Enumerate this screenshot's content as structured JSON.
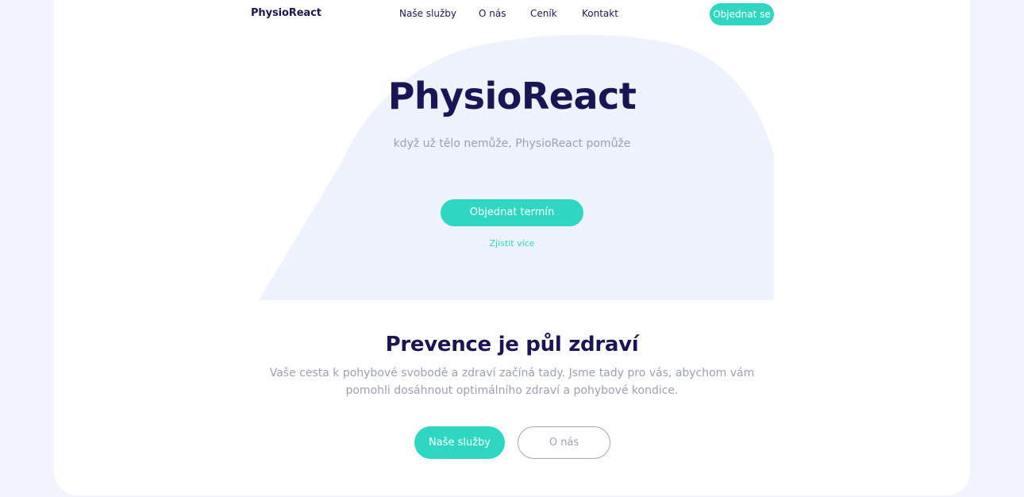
{
  "nav": {
    "brand": "PhysioReact",
    "links": [
      "Naše služby",
      "O nás",
      "Ceník",
      "Kontakt"
    ],
    "cta": "Objednat se"
  },
  "hero": {
    "title": "PhysioReact",
    "subtitle": "když už tělo nemůže, PhysioReact pomůže",
    "button": "Objednat termín",
    "link": "Zjistit více"
  },
  "section": {
    "title": "Prevence je půl zdraví",
    "text": "Vaše cesta k pohybové svobodě a zdraví začíná tady. Jsme tady pro vás, abychom vám pomohli dosáhnout optimálního zdraví a pohybové kondice.",
    "primary_button": "Naše služby",
    "secondary_button": "O nás"
  },
  "colors": {
    "page_background": "#f1f4fd",
    "card": "#ffffff",
    "hero_blob": "#eef2fc",
    "accent": "#2fd7c2",
    "heading": "#1a1656",
    "muted_text": "#9aa0b5"
  }
}
